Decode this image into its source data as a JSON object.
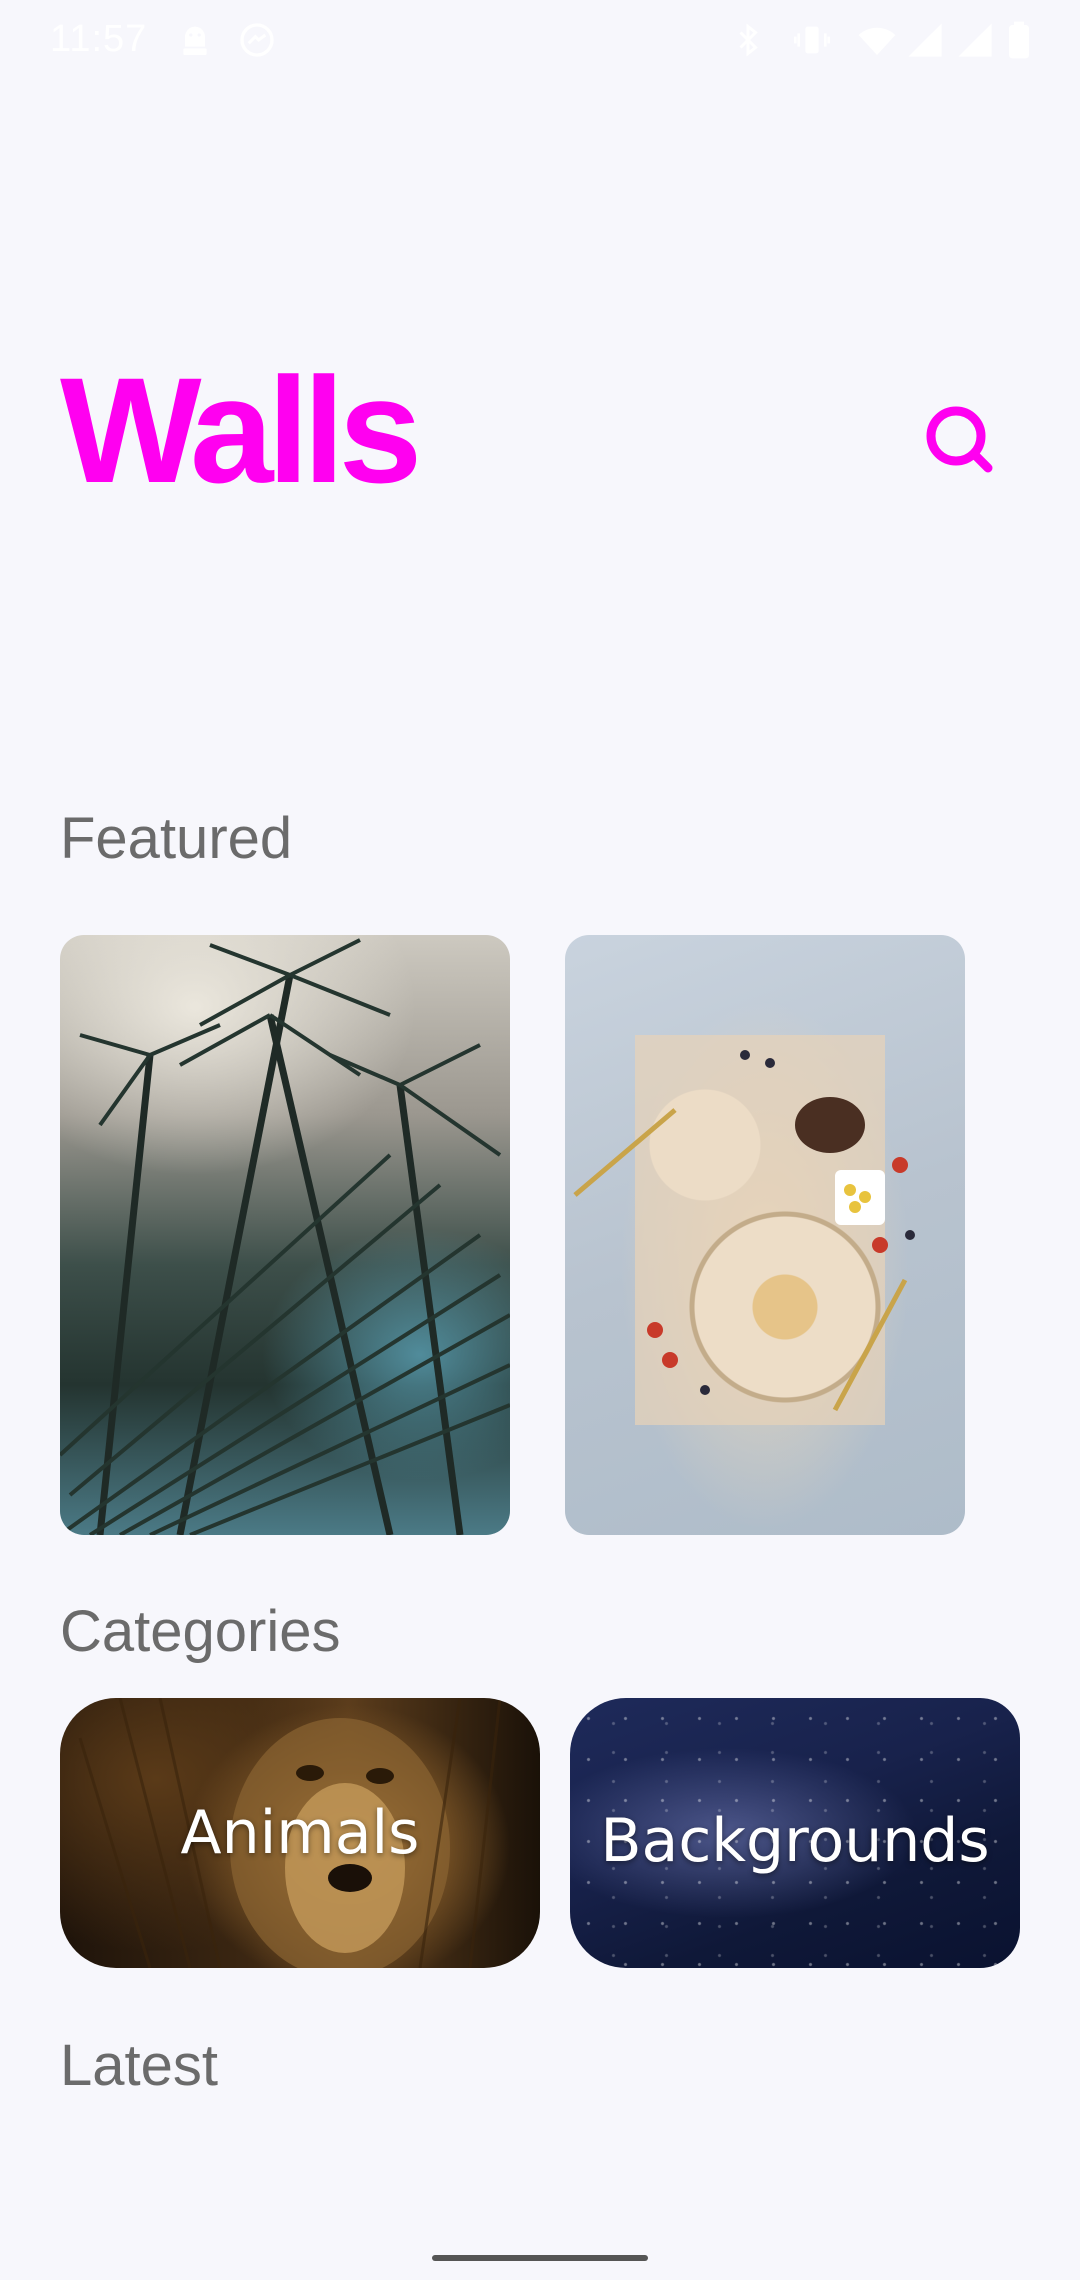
{
  "status_bar": {
    "time": "11:57",
    "icons": [
      "android-debug-icon",
      "messenger-icon",
      "bluetooth-icon",
      "vibrate-icon",
      "wifi-icon",
      "signal-icon",
      "signal-icon",
      "battery-icon"
    ]
  },
  "header": {
    "title": "Walls",
    "search_icon": "search-icon",
    "accent_color": "#ff00f0"
  },
  "featured": {
    "title": "Featured",
    "items": [
      {
        "subject": "palm trees against a cloudy sky"
      },
      {
        "subject": "soup bowls and bread on linen over newspaper"
      }
    ]
  },
  "categories": {
    "title": "Categories",
    "items": [
      {
        "label": "Animals"
      },
      {
        "label": "Backgrounds"
      }
    ]
  },
  "latest": {
    "title": "Latest"
  }
}
